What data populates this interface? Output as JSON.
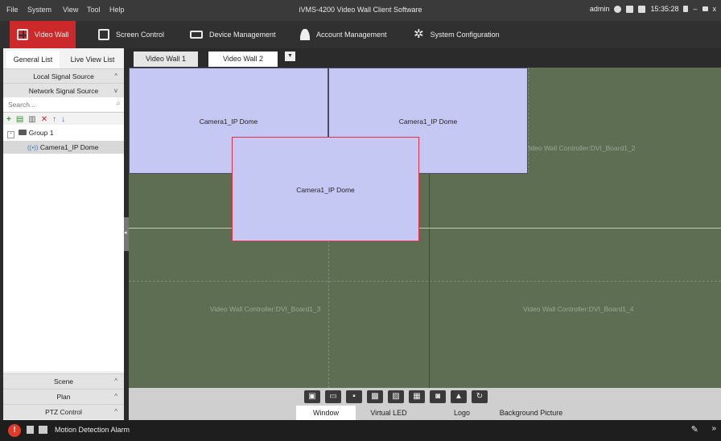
{
  "app_title": "iVMS-4200 Video Wall Client Software",
  "menu": [
    "File",
    "System",
    "View",
    "Tool",
    "Help"
  ],
  "status": {
    "user": "admin",
    "time": "15:35:28"
  },
  "modules": {
    "video_wall": "Video Wall",
    "screen_control": "Screen Control",
    "device_management": "Device Management",
    "account_management": "Account Management",
    "system_configuration": "System Configuration"
  },
  "left_tabs": {
    "general": "General List",
    "live": "Live View List"
  },
  "accordion": {
    "local_signal": "Local Signal Source",
    "network_signal": "Network Signal Source",
    "scene": "Scene",
    "plan": "Plan",
    "ptz": "PTZ Control"
  },
  "search": {
    "placeholder": "Search..."
  },
  "tree": {
    "group": "Group 1",
    "camera": "Camera1_IP Dome"
  },
  "wall_tabs": [
    "Video Wall 1",
    "Video Wall 2"
  ],
  "windows": [
    "Camera1_IP Dome",
    "Camera1_IP Dome",
    "Camera1_IP Dome"
  ],
  "screens": {
    "board2": "Video Wall Controller:DVI_Board1_2",
    "board3": "Video Wall Controller:DVI_Board1_3",
    "board4": "Video Wall Controller:DVI_Board1_4"
  },
  "bottom_tabs": [
    "Window",
    "Virtual LED",
    "Logo",
    "Background Picture"
  ],
  "statusbar": {
    "alarm_text": "Motion Detection Alarm"
  },
  "colors": {
    "accent": "#cc2a2a",
    "wall_bg": "#5e6e53",
    "window_bg": "#c6c8f4",
    "selected_border": "#e0304a"
  }
}
